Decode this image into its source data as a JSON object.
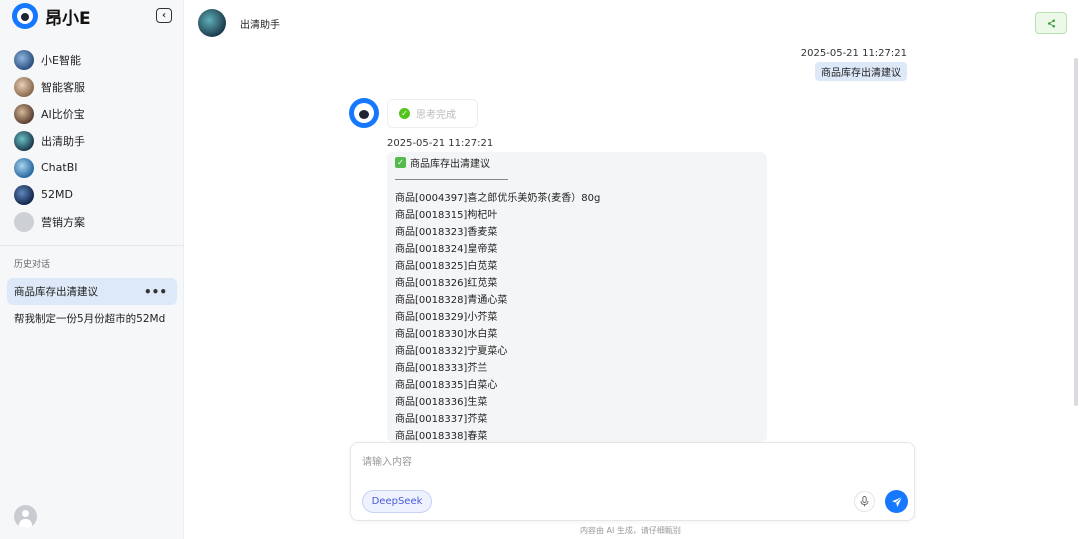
{
  "brand": {
    "name": "昂小E"
  },
  "nav": {
    "items": [
      {
        "label": "小E智能",
        "avatar_color": "#3a6fa8"
      },
      {
        "label": "智能客服",
        "avatar_color": "#b78c6a"
      },
      {
        "label": "AI比价宝",
        "avatar_color": "#8a6a56"
      },
      {
        "label": "出清助手",
        "avatar_color": "#2f6f7f"
      },
      {
        "label": "ChatBI",
        "avatar_color": "#4a8fc0"
      },
      {
        "label": "52MD",
        "avatar_color": "#1f3f6a"
      },
      {
        "label": "营销方案",
        "avatar_color": "#c8cbd0"
      }
    ]
  },
  "history": {
    "title": "历史对话",
    "items": [
      {
        "label": "商品库存出清建议",
        "more": "•••"
      },
      {
        "label": "帮我制定一份5月份超市的52Md"
      }
    ]
  },
  "header": {
    "title": "出清助手"
  },
  "chat": {
    "user_time": "2025-05-21 11:27:21",
    "user_msg": "商品库存出清建议",
    "think_label": "思考完成",
    "bot_time": "2025-05-21 11:27:21",
    "bot_title": "商品库存出清建议",
    "products": [
      "商品[0004397]喜之郎优乐美奶茶(麦香）80g",
      "商品[0018315]枸杞叶",
      "商品[0018323]香麦菜",
      "商品[0018324]皇帝菜",
      "商品[0018325]白苋菜",
      "商品[0018326]红苋菜",
      "商品[0018328]青通心菜",
      "商品[0018329]小芥菜",
      "商品[0018330]水白菜",
      "商品[0018332]宁夏菜心",
      "商品[0018333]芥兰",
      "商品[0018335]白菜心",
      "商品[0018336]生菜",
      "商品[0018337]芥菜",
      "商品[0018338]春菜"
    ]
  },
  "input": {
    "placeholder": "请输入内容",
    "model_label": "DeepSeek"
  },
  "footer": {
    "note": "内容由 AI 生成，请仔细甄别"
  },
  "colors": {
    "accent": "#1677ff",
    "active_bg": "#dde8f8",
    "success": "#52c41a"
  }
}
